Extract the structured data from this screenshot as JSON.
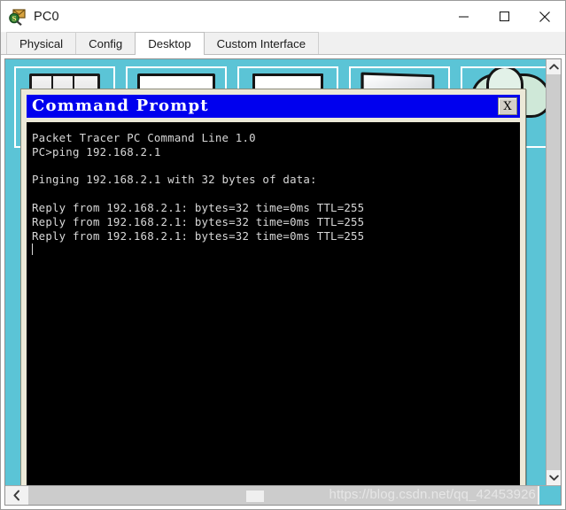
{
  "window": {
    "title": "PC0",
    "icon": "packet-tracer-device-icon",
    "controls": {
      "minimize": "minimize-icon",
      "maximize": "maximize-icon",
      "close": "close-icon"
    }
  },
  "tabs": [
    {
      "label": "Physical",
      "active": false
    },
    {
      "label": "Config",
      "active": false
    },
    {
      "label": "Desktop",
      "active": true
    },
    {
      "label": "Custom Interface",
      "active": false
    }
  ],
  "desktop": {
    "background_color": "#5bc4d6",
    "icons": [
      {
        "name": "ip-configuration",
        "glyph": "monitor-split-icon"
      },
      {
        "name": "dial-up",
        "glyph": "envelope-icon"
      },
      {
        "name": "terminal",
        "glyph": "page-icon"
      },
      {
        "name": "command-prompt",
        "glyph": "laptop-icon"
      },
      {
        "name": "web-browser",
        "glyph": "cloud-icon"
      }
    ]
  },
  "cmd_window": {
    "title": "Command Prompt",
    "titlebar_color": "#0000ee",
    "close_label": "X",
    "screen_background": "#000000",
    "text_color": "#d8d8d8",
    "lines": [
      "Packet Tracer PC Command Line 1.0",
      "PC>ping 192.168.2.1",
      "",
      "Pinging 192.168.2.1 with 32 bytes of data:",
      "",
      "Reply from 192.168.2.1: bytes=32 time=0ms TTL=255",
      "Reply from 192.168.2.1: bytes=32 time=0ms TTL=255",
      "Reply from 192.168.2.1: bytes=32 time=0ms TTL=255"
    ]
  },
  "scrollbars": {
    "vertical": {
      "up_arrow": "chevron-up-icon",
      "down_arrow": "chevron-down-icon"
    },
    "horizontal": {
      "left_arrow": "chevron-left-icon",
      "right_arrow": "chevron-right-icon"
    }
  },
  "watermark": {
    "text": "https://blog.csdn.net/qq_42453926"
  }
}
